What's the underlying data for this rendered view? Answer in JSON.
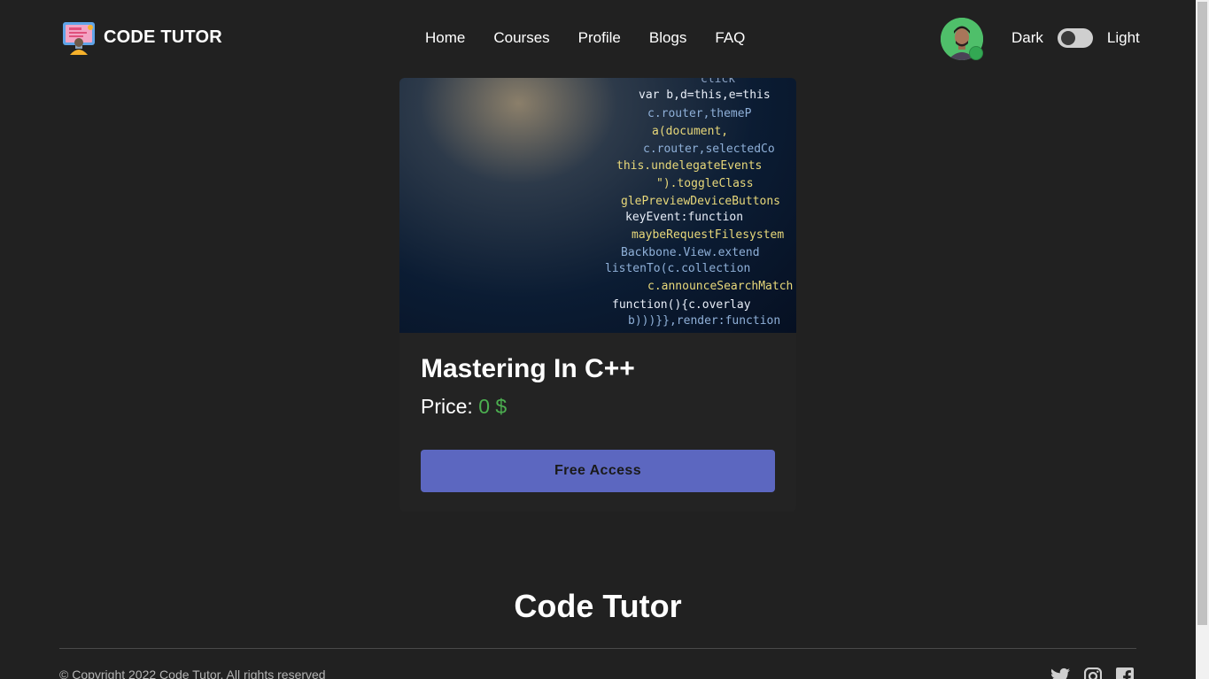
{
  "brand": {
    "name": "CODE TUTOR",
    "logo_icon": "computer-monitor-icon"
  },
  "nav": {
    "items": [
      {
        "label": "Home"
      },
      {
        "label": "Courses"
      },
      {
        "label": "Profile"
      },
      {
        "label": "Blogs"
      },
      {
        "label": "FAQ"
      }
    ]
  },
  "user": {
    "avatar_icon": "user-avatar",
    "status_color": "#33a853"
  },
  "theme": {
    "dark_label": "Dark",
    "light_label": "Light",
    "toggle_state": "dark"
  },
  "course": {
    "image_lines": [
      "click",
      "var b,d=this,e=this",
      "c.router,themeP",
      "a(document,",
      "c.router,selectedCo",
      "this.undelegateEvents",
      "\").toggleClass",
      "glePreviewDeviceButtons",
      "keyEvent:function",
      "maybeRequestFilesystem",
      "Backbone.View.extend",
      "listenTo(c.collection",
      "c.announceSearchMatch",
      "function(){c.overlay",
      "b)))}},render:function"
    ],
    "title": "Mastering In C++",
    "price_label": "Price:",
    "price_value": "0 $",
    "button_label": "Free Access"
  },
  "footer": {
    "title": "Code Tutor",
    "copyright": "© Copyright 2022 Code Tutor. All rights reserved",
    "social_icons": [
      "twitter-icon",
      "instagram-icon",
      "facebook-icon"
    ]
  },
  "colors": {
    "background": "#212121",
    "accent": "#5c67c0",
    "price": "#4caf50"
  }
}
